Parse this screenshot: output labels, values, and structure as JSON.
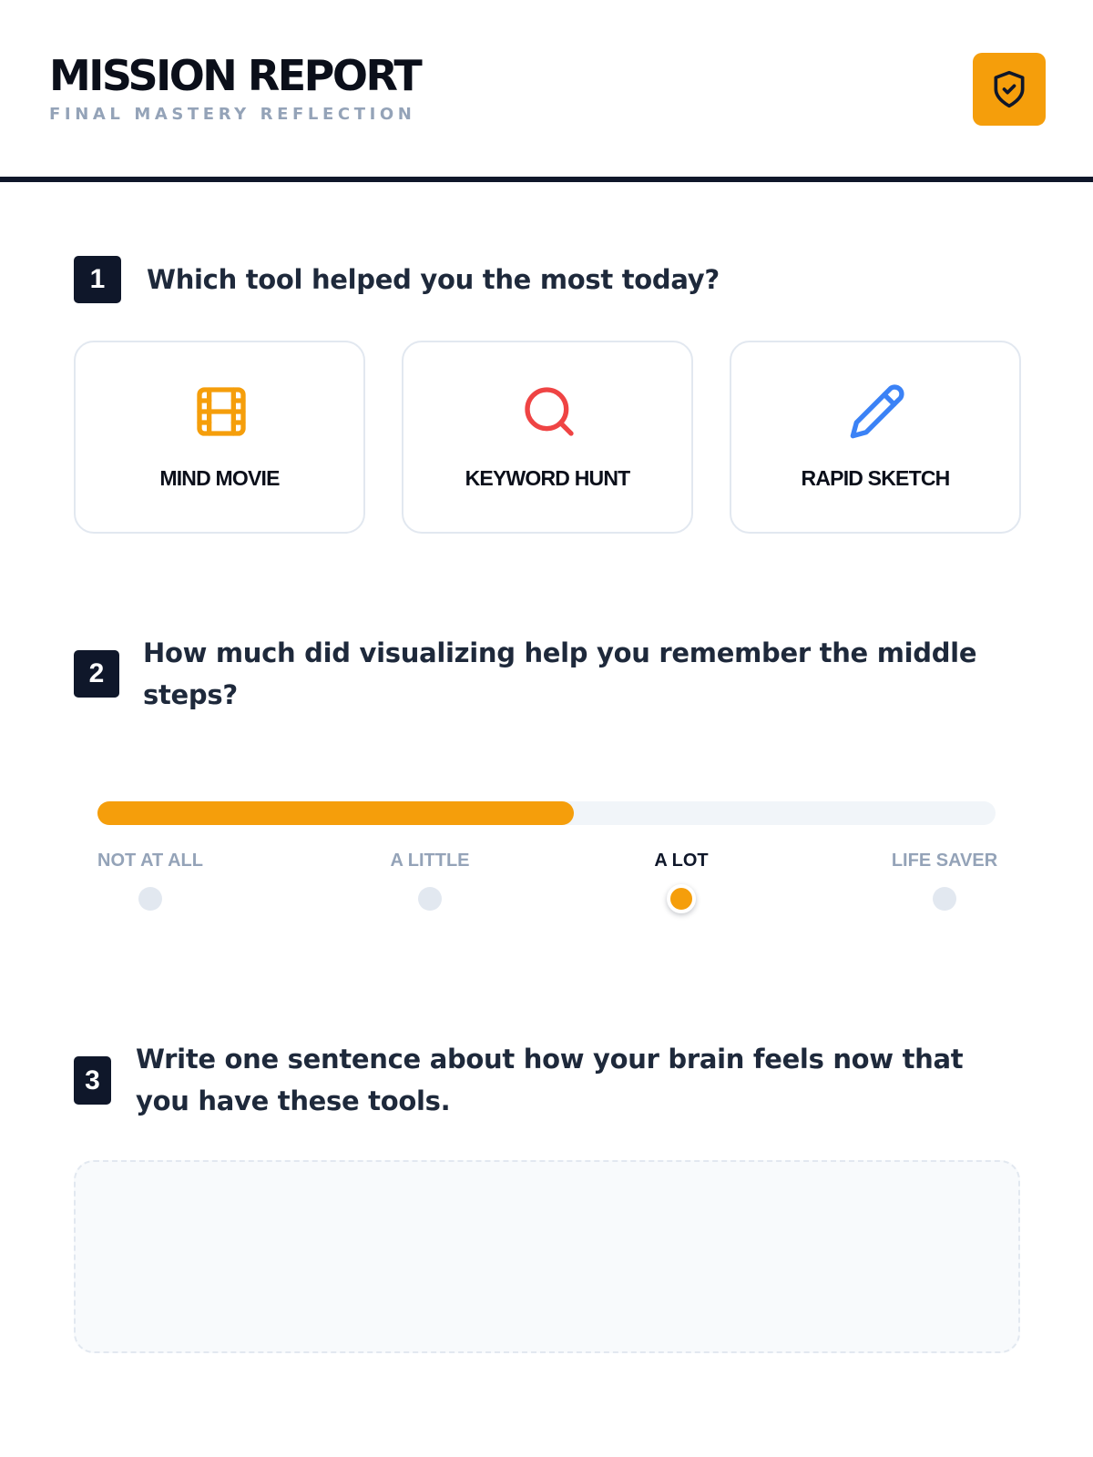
{
  "header": {
    "title": "MISSION REPORT",
    "subtitle": "FINAL MASTERY REFLECTION",
    "badge_icon": "shield-check-icon",
    "accent_color": "#f59e0b"
  },
  "questions": [
    {
      "number": "1",
      "text": "Which tool helped you the most today?"
    },
    {
      "number": "2",
      "text": "How much did visualizing help you remember the middle steps?"
    },
    {
      "number": "3",
      "text": "Write one sentence about how your brain feels now that you have these tools."
    }
  ],
  "tools": [
    {
      "label": "MIND MOVIE",
      "icon": "film-icon",
      "color": "#f59e0b"
    },
    {
      "label": "KEYWORD HUNT",
      "icon": "search-icon",
      "color": "#ef4444"
    },
    {
      "label": "RAPID SKETCH",
      "icon": "pencil-icon",
      "color": "#3b82f6"
    }
  ],
  "scale": {
    "options": [
      "NOT AT ALL",
      "A LITTLE",
      "A LOT",
      "LIFE SAVER"
    ],
    "selected_index": 2,
    "fill_percent": 53
  },
  "answer": {
    "value": "",
    "placeholder": ""
  }
}
